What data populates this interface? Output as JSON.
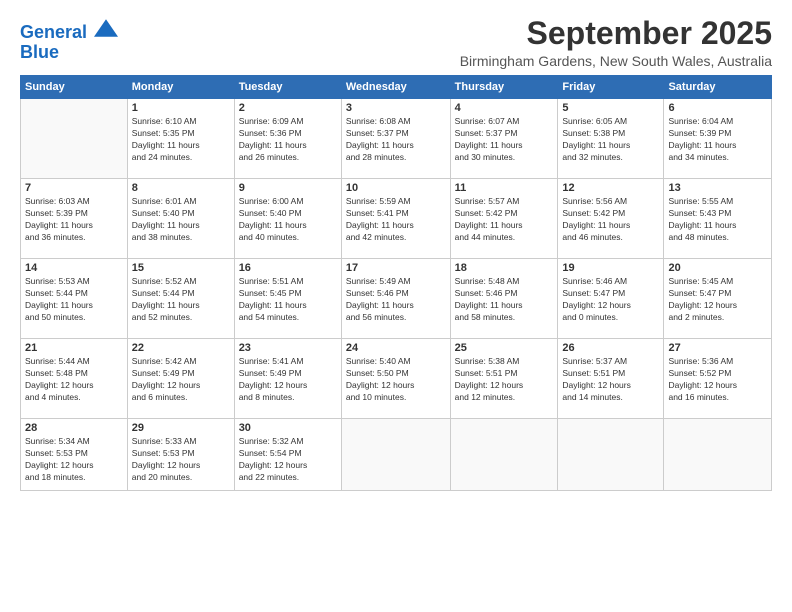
{
  "header": {
    "logo_line1": "General",
    "logo_line2": "Blue",
    "month": "September 2025",
    "location": "Birmingham Gardens, New South Wales, Australia"
  },
  "weekdays": [
    "Sunday",
    "Monday",
    "Tuesday",
    "Wednesday",
    "Thursday",
    "Friday",
    "Saturday"
  ],
  "weeks": [
    [
      {
        "day": "",
        "info": ""
      },
      {
        "day": "1",
        "info": "Sunrise: 6:10 AM\nSunset: 5:35 PM\nDaylight: 11 hours\nand 24 minutes."
      },
      {
        "day": "2",
        "info": "Sunrise: 6:09 AM\nSunset: 5:36 PM\nDaylight: 11 hours\nand 26 minutes."
      },
      {
        "day": "3",
        "info": "Sunrise: 6:08 AM\nSunset: 5:37 PM\nDaylight: 11 hours\nand 28 minutes."
      },
      {
        "day": "4",
        "info": "Sunrise: 6:07 AM\nSunset: 5:37 PM\nDaylight: 11 hours\nand 30 minutes."
      },
      {
        "day": "5",
        "info": "Sunrise: 6:05 AM\nSunset: 5:38 PM\nDaylight: 11 hours\nand 32 minutes."
      },
      {
        "day": "6",
        "info": "Sunrise: 6:04 AM\nSunset: 5:39 PM\nDaylight: 11 hours\nand 34 minutes."
      }
    ],
    [
      {
        "day": "7",
        "info": "Sunrise: 6:03 AM\nSunset: 5:39 PM\nDaylight: 11 hours\nand 36 minutes."
      },
      {
        "day": "8",
        "info": "Sunrise: 6:01 AM\nSunset: 5:40 PM\nDaylight: 11 hours\nand 38 minutes."
      },
      {
        "day": "9",
        "info": "Sunrise: 6:00 AM\nSunset: 5:40 PM\nDaylight: 11 hours\nand 40 minutes."
      },
      {
        "day": "10",
        "info": "Sunrise: 5:59 AM\nSunset: 5:41 PM\nDaylight: 11 hours\nand 42 minutes."
      },
      {
        "day": "11",
        "info": "Sunrise: 5:57 AM\nSunset: 5:42 PM\nDaylight: 11 hours\nand 44 minutes."
      },
      {
        "day": "12",
        "info": "Sunrise: 5:56 AM\nSunset: 5:42 PM\nDaylight: 11 hours\nand 46 minutes."
      },
      {
        "day": "13",
        "info": "Sunrise: 5:55 AM\nSunset: 5:43 PM\nDaylight: 11 hours\nand 48 minutes."
      }
    ],
    [
      {
        "day": "14",
        "info": "Sunrise: 5:53 AM\nSunset: 5:44 PM\nDaylight: 11 hours\nand 50 minutes."
      },
      {
        "day": "15",
        "info": "Sunrise: 5:52 AM\nSunset: 5:44 PM\nDaylight: 11 hours\nand 52 minutes."
      },
      {
        "day": "16",
        "info": "Sunrise: 5:51 AM\nSunset: 5:45 PM\nDaylight: 11 hours\nand 54 minutes."
      },
      {
        "day": "17",
        "info": "Sunrise: 5:49 AM\nSunset: 5:46 PM\nDaylight: 11 hours\nand 56 minutes."
      },
      {
        "day": "18",
        "info": "Sunrise: 5:48 AM\nSunset: 5:46 PM\nDaylight: 11 hours\nand 58 minutes."
      },
      {
        "day": "19",
        "info": "Sunrise: 5:46 AM\nSunset: 5:47 PM\nDaylight: 12 hours\nand 0 minutes."
      },
      {
        "day": "20",
        "info": "Sunrise: 5:45 AM\nSunset: 5:47 PM\nDaylight: 12 hours\nand 2 minutes."
      }
    ],
    [
      {
        "day": "21",
        "info": "Sunrise: 5:44 AM\nSunset: 5:48 PM\nDaylight: 12 hours\nand 4 minutes."
      },
      {
        "day": "22",
        "info": "Sunrise: 5:42 AM\nSunset: 5:49 PM\nDaylight: 12 hours\nand 6 minutes."
      },
      {
        "day": "23",
        "info": "Sunrise: 5:41 AM\nSunset: 5:49 PM\nDaylight: 12 hours\nand 8 minutes."
      },
      {
        "day": "24",
        "info": "Sunrise: 5:40 AM\nSunset: 5:50 PM\nDaylight: 12 hours\nand 10 minutes."
      },
      {
        "day": "25",
        "info": "Sunrise: 5:38 AM\nSunset: 5:51 PM\nDaylight: 12 hours\nand 12 minutes."
      },
      {
        "day": "26",
        "info": "Sunrise: 5:37 AM\nSunset: 5:51 PM\nDaylight: 12 hours\nand 14 minutes."
      },
      {
        "day": "27",
        "info": "Sunrise: 5:36 AM\nSunset: 5:52 PM\nDaylight: 12 hours\nand 16 minutes."
      }
    ],
    [
      {
        "day": "28",
        "info": "Sunrise: 5:34 AM\nSunset: 5:53 PM\nDaylight: 12 hours\nand 18 minutes."
      },
      {
        "day": "29",
        "info": "Sunrise: 5:33 AM\nSunset: 5:53 PM\nDaylight: 12 hours\nand 20 minutes."
      },
      {
        "day": "30",
        "info": "Sunrise: 5:32 AM\nSunset: 5:54 PM\nDaylight: 12 hours\nand 22 minutes."
      },
      {
        "day": "",
        "info": ""
      },
      {
        "day": "",
        "info": ""
      },
      {
        "day": "",
        "info": ""
      },
      {
        "day": "",
        "info": ""
      }
    ]
  ]
}
